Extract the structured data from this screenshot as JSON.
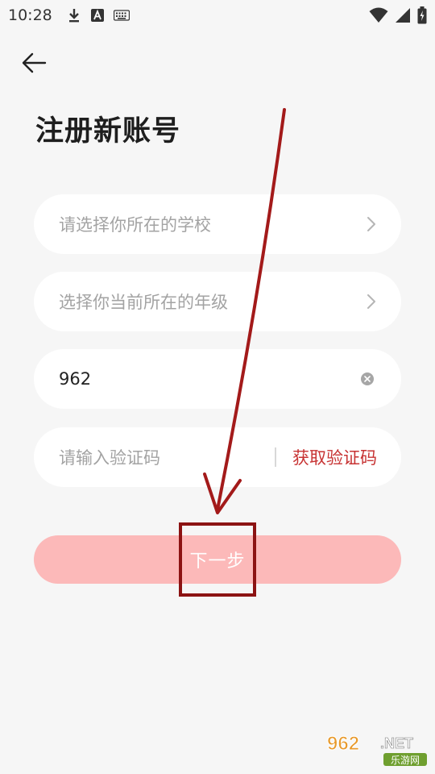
{
  "status_bar": {
    "time": "10:28"
  },
  "page": {
    "title": "注册新账号"
  },
  "form": {
    "school_placeholder": "请选择你所在的学校",
    "grade_placeholder": "选择你当前所在的年级",
    "phone_value": "962",
    "code_placeholder": "请输入验证码",
    "get_code_label": "获取验证码",
    "next_label": "下一步"
  },
  "colors": {
    "accent": "#c73333",
    "button_disabled": "#fcb9b9",
    "annotation": "#8c1313"
  },
  "watermark": {
    "brand": "962",
    "domain": ".NET",
    "subtitle": "乐游网"
  }
}
